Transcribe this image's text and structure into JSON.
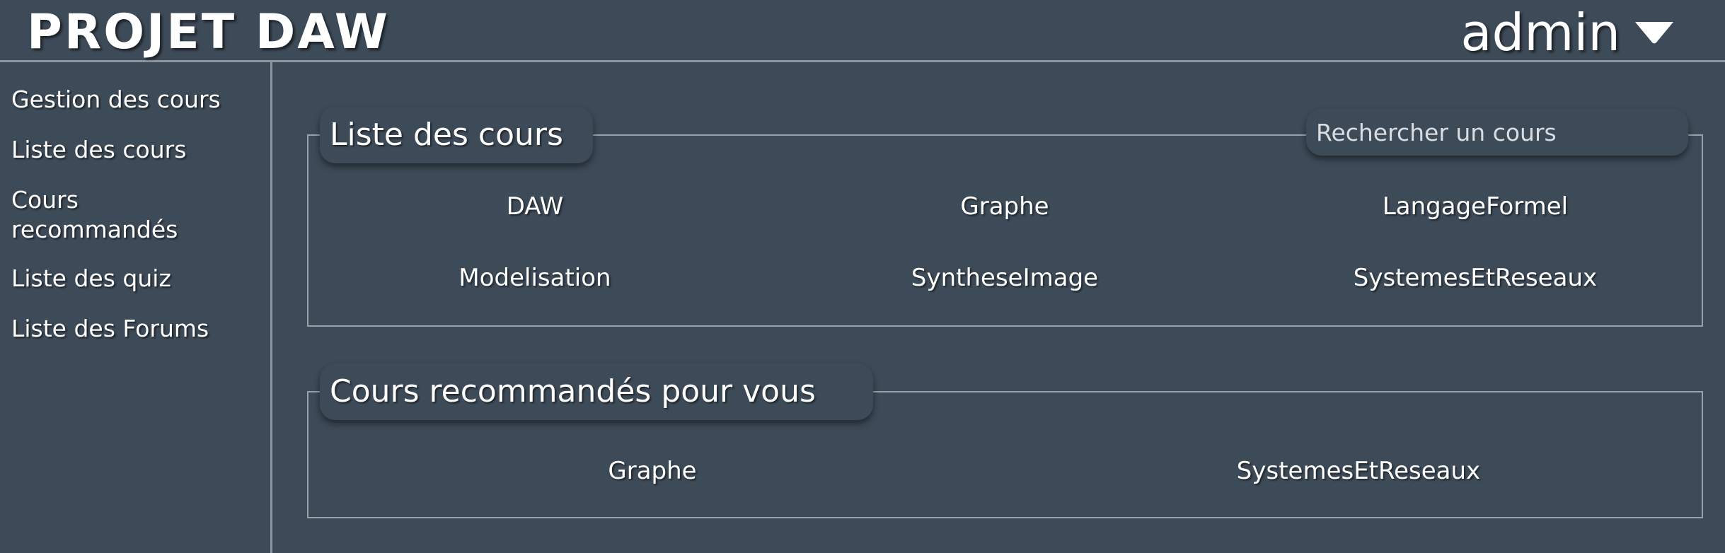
{
  "header": {
    "brand": "PROJET DAW",
    "user_name": "admin"
  },
  "sidebar": {
    "items": [
      {
        "label": "Gestion des cours"
      },
      {
        "label": "Liste des cours"
      },
      {
        "label": "Cours recommandés"
      },
      {
        "label": "Liste des quiz"
      },
      {
        "label": "Liste des Forums"
      }
    ]
  },
  "course_list": {
    "title": "Liste des cours",
    "search_placeholder": "Rechercher un cours",
    "courses": [
      "DAW",
      "Graphe",
      "LangageFormel",
      "Modelisation",
      "SyntheseImage",
      "SystemesEtReseaux"
    ]
  },
  "recommended": {
    "title": "Cours recommandés pour vous",
    "courses": [
      "Graphe",
      "SystemesEtReseaux"
    ]
  },
  "icons": {
    "user_menu": "caret-down-icon"
  },
  "colors": {
    "background": "#3d4a57",
    "border": "#9aa1a8",
    "text": "#ffffff"
  }
}
